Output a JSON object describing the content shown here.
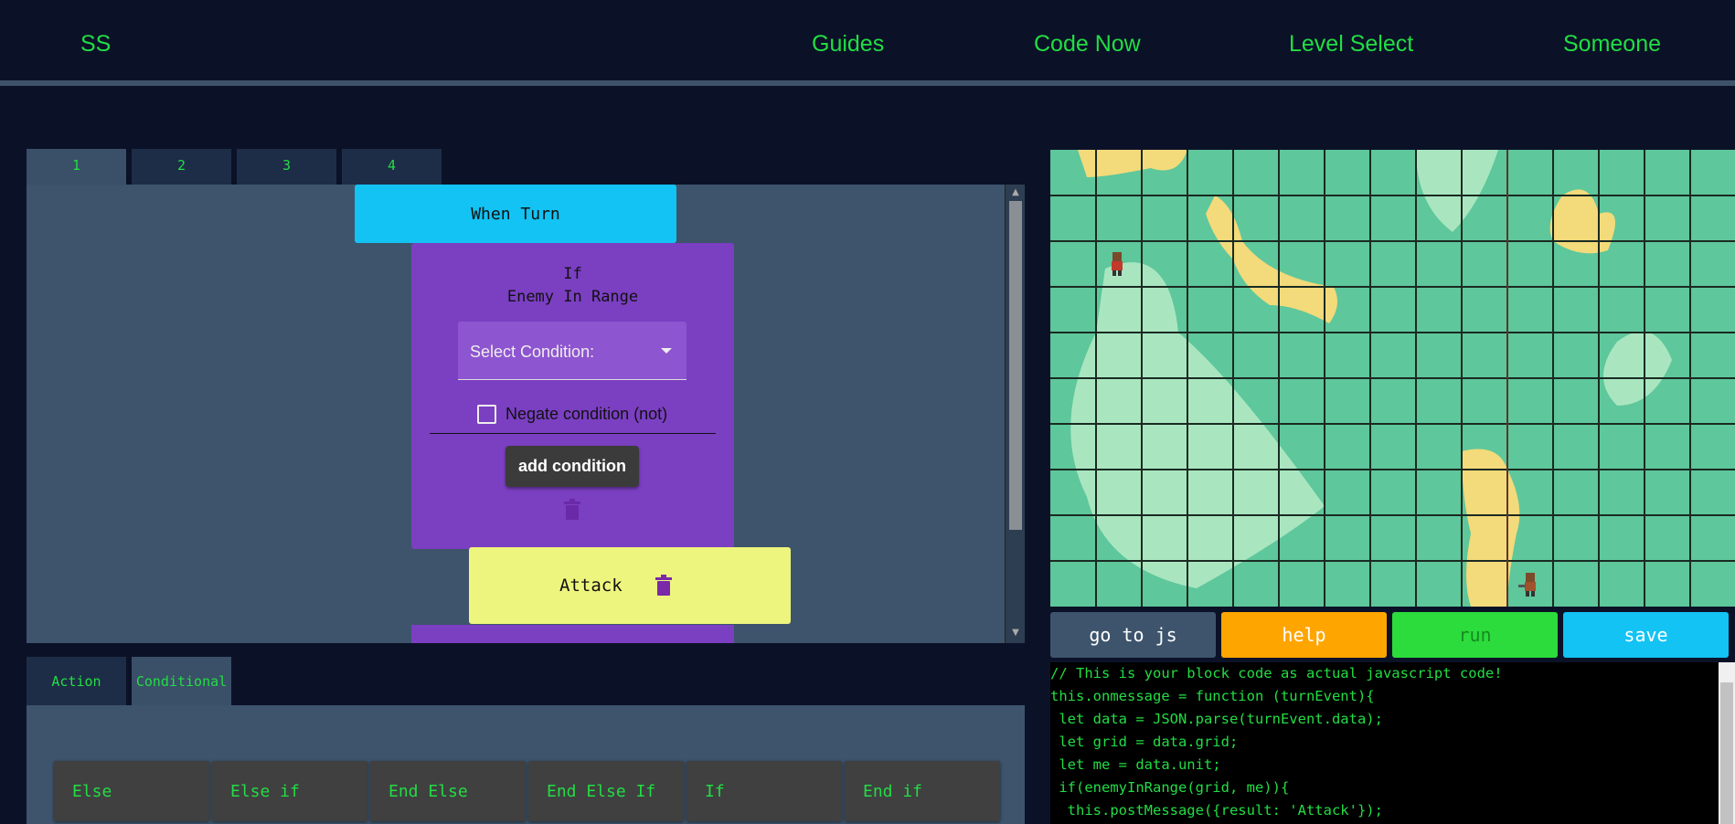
{
  "navbar": {
    "brand": "SS",
    "links": [
      "Guides",
      "Code Now",
      "Level Select",
      "Someone"
    ]
  },
  "editor_tabs": [
    "1",
    "2",
    "3",
    "4"
  ],
  "editor_active_tab": "1",
  "blocks": {
    "when_turn": "When Turn",
    "if_title": "If",
    "if_condition": "Enemy In Range",
    "select_placeholder": "Select Condition:",
    "negate_label": "Negate condition (not)",
    "add_condition": "add condition",
    "attack": "Attack"
  },
  "category_tabs": [
    "Action",
    "Conditional"
  ],
  "category_active": "Conditional",
  "palette": [
    "Else",
    "Else if",
    "End Else",
    "End Else If",
    "If",
    "End if"
  ],
  "actions": {
    "go_to_js": "go to js",
    "help": "help",
    "run": "run",
    "save": "save"
  },
  "colors": {
    "accent_green": "#22dd44",
    "when_block": "#12c3f4",
    "if_block": "#7b3fc2",
    "attack_block": "#eef57e",
    "help": "#ffa500",
    "run": "#2bdc3c",
    "save": "#12c3f4"
  },
  "code_lines": [
    "// This is your block code as actual javascript code!",
    "this.onmessage = function (turnEvent){",
    " let data = JSON.parse(turnEvent.data);",
    " let grid = data.grid;",
    " let me = data.unit;",
    " if(enemyInRange(grid, me)){",
    "  this.postMessage({result: 'Attack'});"
  ]
}
